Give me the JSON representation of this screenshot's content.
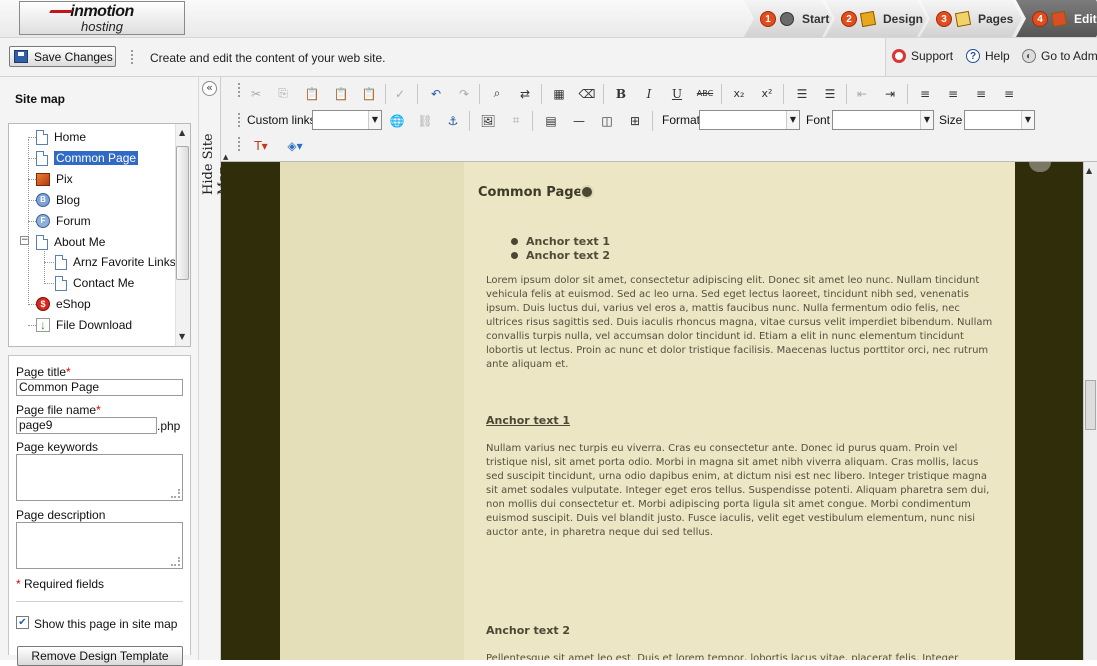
{
  "brand": {
    "line1": "inmotion",
    "line2": "hosting"
  },
  "steps": [
    {
      "num": "1",
      "label": "Start"
    },
    {
      "num": "2",
      "label": "Design"
    },
    {
      "num": "3",
      "label": "Pages"
    },
    {
      "num": "4",
      "label": "Edit"
    }
  ],
  "toolbar2": {
    "save_label": "Save Changes",
    "description": "Create and edit the content of your web site.",
    "support_label": "Support",
    "help_label": "Help",
    "admin_label": "Go to Admin"
  },
  "sidebar": {
    "title": "Site map",
    "hide_label": "Hide Site Map",
    "tree": [
      {
        "label": "Home",
        "icon": "page-icon",
        "level": 0,
        "selected": false
      },
      {
        "label": "Common Page",
        "icon": "page-icon",
        "level": 0,
        "selected": true
      },
      {
        "label": "Pix",
        "icon": "gallery-icon",
        "level": 0,
        "selected": false
      },
      {
        "label": "Blog",
        "icon": "blog-icon",
        "level": 0,
        "selected": false
      },
      {
        "label": "Forum",
        "icon": "forum-icon",
        "level": 0,
        "selected": false
      },
      {
        "label": "About Me",
        "icon": "page-icon",
        "level": 0,
        "selected": false,
        "expanded": true
      },
      {
        "label": "Arnz Favorite Links",
        "icon": "page-icon",
        "level": 1,
        "selected": false
      },
      {
        "label": "Contact Me",
        "icon": "page-icon",
        "level": 1,
        "selected": false
      },
      {
        "label": "eShop",
        "icon": "eshop-icon",
        "level": 0,
        "selected": false
      },
      {
        "label": "File Download",
        "icon": "download-icon",
        "level": 0,
        "selected": false
      }
    ]
  },
  "form": {
    "page_title_label": "Page title",
    "page_title_value": "Common Page",
    "file_name_label": "Page file name",
    "file_name_value": "page9",
    "file_ext": ".php",
    "keywords_label": "Page keywords",
    "description_label": "Page description",
    "required_star": "*",
    "required_note": "Required fields",
    "show_in_sitemap_label": "Show this page in site map",
    "show_in_sitemap_checked": true,
    "remove_template_label": "Remove Design Template"
  },
  "editor_toolbar": {
    "custom_links_label": "Custom links",
    "format_label": "Format",
    "font_label": "Font",
    "size_label": "Size"
  },
  "content": {
    "title": "Common Page",
    "anchors": [
      "Anchor text 1",
      "Anchor text 2"
    ],
    "paragraph1": "Lorem ipsum dolor sit amet, consectetur adipiscing elit. Donec sit amet leo nunc. Nullam tincidunt vehicula felis at euismod. Sed ac leo urna. Sed eget lectus laoreet, tincidunt nibh sed, venenatis ipsum. Duis luctus dui, varius vel eros a, mattis faucibus nunc. Nulla fermentum odio felis, nec ultrices risus sagittis sed. Duis iaculis rhoncus magna, vitae cursus velit imperdiet bibendum. Nullam convallis turpis nulla, vel accumsan dolor tincidunt id. Etiam a elit in nunc elementum tincidunt lobortis ut lectus. Proin ac nunc et dolor tristique facilisis. Maecenas luctus porttitor orci, nec rutrum ante aliquam et.",
    "section1_heading": "Anchor text 1",
    "paragraph2": "Nullam varius nec turpis eu viverra. Cras eu consectetur ante. Donec id purus quam. Proin vel tristique nisl, sit amet porta odio. Morbi in magna sit amet nibh viverra aliquam. Cras mollis, lacus sed suscipit tincidunt, urna odio dapibus enim, at dictum nisi est nec libero. Integer tristique magna sit amet sodales vulputate. Integer eget eros tellus. Suspendisse potenti. Aliquam pharetra sem dui, non mollis dui consectetur et. Morbi adipiscing porta ligula sit amet congue. Morbi condimentum euismod suscipit. Duis vel blandit justo. Fusce iaculis, velit eget vestibulum elementum, nunc nisi auctor ante, in pharetra neque dui sed tellus.",
    "section2_heading": "Anchor text 2",
    "paragraph3": "Pellentesque sit amet leo est. Duis et lorem tempor, lobortis lacus vitae, placerat felis. Integer euismod"
  },
  "colors": {
    "accent": "#316ac5",
    "required": "#dd0000",
    "editor_bg": "#302e0a",
    "content_bg": "#ece6c4"
  }
}
